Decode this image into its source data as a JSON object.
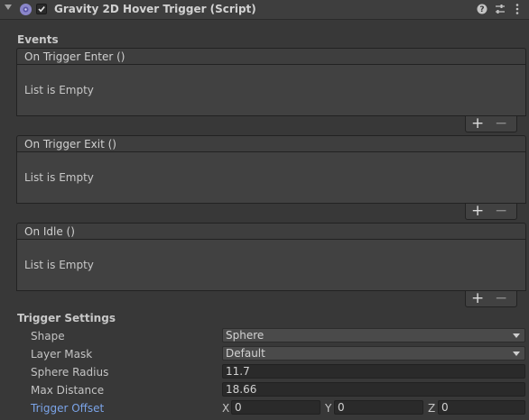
{
  "header": {
    "title": "Gravity 2D Hover Trigger (Script)",
    "enabled": true,
    "icons": [
      "foldout-arrow-icon",
      "script-icon",
      "checkbox-icon",
      "help-icon",
      "preset-icon",
      "menu-icon"
    ]
  },
  "events": {
    "label": "Events",
    "list": [
      {
        "title": "On Trigger Enter ()",
        "empty_text": "List is Empty",
        "add": "+",
        "remove": "−"
      },
      {
        "title": "On Trigger Exit ()",
        "empty_text": "List is Empty",
        "add": "+",
        "remove": "−"
      },
      {
        "title": "On Idle ()",
        "empty_text": "List is Empty",
        "add": "+",
        "remove": "−"
      }
    ]
  },
  "trigger_settings": {
    "label": "Trigger Settings",
    "shape": {
      "label": "Shape",
      "value": "Sphere"
    },
    "layer_mask": {
      "label": "Layer Mask",
      "value": "Default"
    },
    "sphere_radius": {
      "label": "Sphere Radius",
      "value": "11.7"
    },
    "max_distance": {
      "label": "Max Distance",
      "value": "18.66"
    },
    "trigger_offset": {
      "label": "Trigger Offset",
      "x_label": "X",
      "x": "0",
      "y_label": "Y",
      "y": "0",
      "z_label": "Z",
      "z": "0"
    }
  },
  "colors": {
    "background": "#383838",
    "header": "#3e3e3e",
    "field": "#2a2a2a",
    "link_label": "#7ba4e8"
  }
}
